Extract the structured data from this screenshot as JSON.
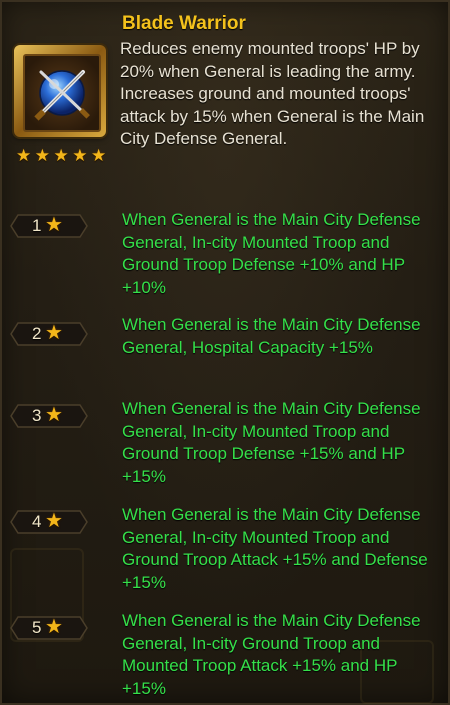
{
  "skill": {
    "name": "Blade Warrior",
    "description": "Reduces enemy mounted troops' HP by 20% when General is leading the army.  Increases ground and mounted troops' attack by 15% when General is the Main City Defense General.",
    "icon": "crossed-swords-orb-icon",
    "stars": 5
  },
  "levels": [
    {
      "num": "1",
      "effect": "When General is the Main City Defense General, In-city Mounted Troop and Ground Troop Defense +10% and HP +10%"
    },
    {
      "num": "2",
      "effect": "When General is the Main City Defense General, Hospital Capacity +15%"
    },
    {
      "num": "3",
      "effect": "When General is the Main City Defense General, In-city Mounted Troop and Ground Troop Defense +15% and HP +15%"
    },
    {
      "num": "4",
      "effect": "When General is the Main City Defense General, In-city Mounted Troop and Ground Troop Attack +15% and Defense +15%"
    },
    {
      "num": "5",
      "effect": "When General is the Main City Defense General, In-city Ground Troop and Mounted Troop Attack +15% and HP +15%"
    }
  ],
  "colors": {
    "title": "#f4c21c",
    "effect_text": "#35e04a",
    "star": "#f3b61a"
  }
}
